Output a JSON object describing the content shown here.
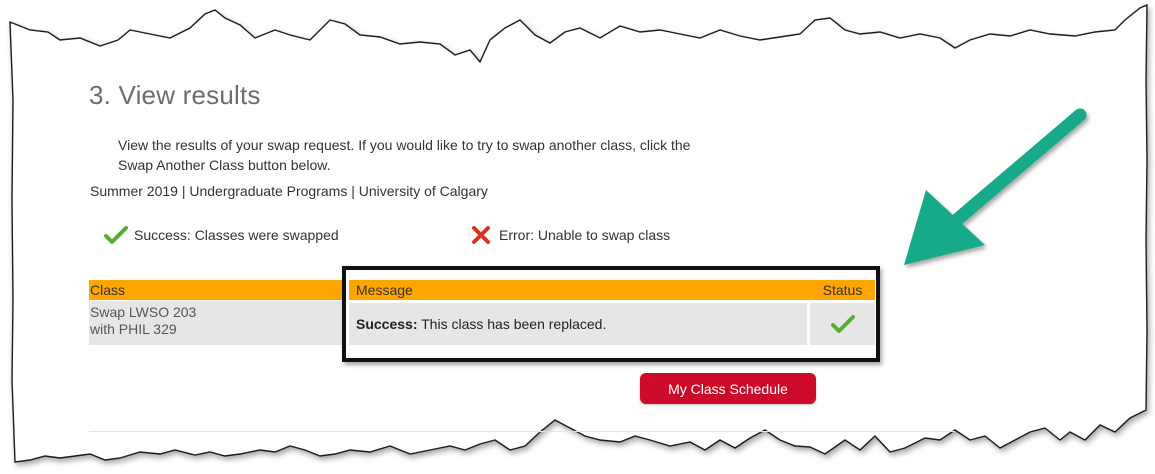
{
  "step": {
    "title": "3.  View results"
  },
  "instructions": {
    "line1": "View the results of your swap request.  If you would like to try to swap another class, click the",
    "line2": "Swap Another Class button below."
  },
  "term_line": "Summer 2019 | Undergraduate Programs | University of Calgary",
  "legend": {
    "success": "Success: Classes were swapped",
    "error": "Error: Unable to swap class"
  },
  "table": {
    "headers": {
      "class": "Class",
      "message": "Message",
      "status": "Status"
    },
    "rows": [
      {
        "class_line1": "Swap LWSO  203",
        "class_line2": "with PHIL  329",
        "message_bold": "Success:",
        "message_text": " This class has been replaced.",
        "status_icon": "checkmark-icon"
      }
    ]
  },
  "buttons": {
    "my_class_schedule": "My Class Schedule"
  },
  "colors": {
    "header_bg": "#ffa500",
    "button_bg": "#cc0b2a",
    "success_green": "#5aac2f",
    "error_red": "#d9331f",
    "arrow_teal": "#17a98a"
  }
}
